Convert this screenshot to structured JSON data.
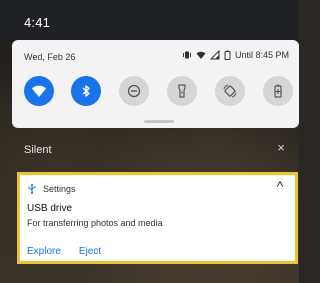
{
  "status_bar": {
    "time": "4:41"
  },
  "quick_settings": {
    "date": "Wed, Feb 26",
    "alarm_text": "Until 8:45 PM",
    "tiles": [
      {
        "name": "wifi-tile",
        "icon": "wifi-icon",
        "state": "on"
      },
      {
        "name": "bluetooth-tile",
        "icon": "bluetooth-icon",
        "state": "on"
      },
      {
        "name": "do-not-disturb-tile",
        "icon": "dnd-icon",
        "state": "off"
      },
      {
        "name": "flashlight-tile",
        "icon": "flashlight-icon",
        "state": "off"
      },
      {
        "name": "auto-rotate-tile",
        "icon": "rotate-icon",
        "state": "off"
      },
      {
        "name": "battery-saver-tile",
        "icon": "battery-saver-icon",
        "state": "off"
      }
    ]
  },
  "silent_section": {
    "label": "Silent",
    "close": "×"
  },
  "notification": {
    "app_name": "Settings",
    "title": "USB drive",
    "text": "For transferring photos and media",
    "actions": [
      "Explore",
      "Eject"
    ],
    "expand": "^"
  },
  "colors": {
    "accent": "#1a73e8",
    "highlight_border": "#f1c232"
  }
}
